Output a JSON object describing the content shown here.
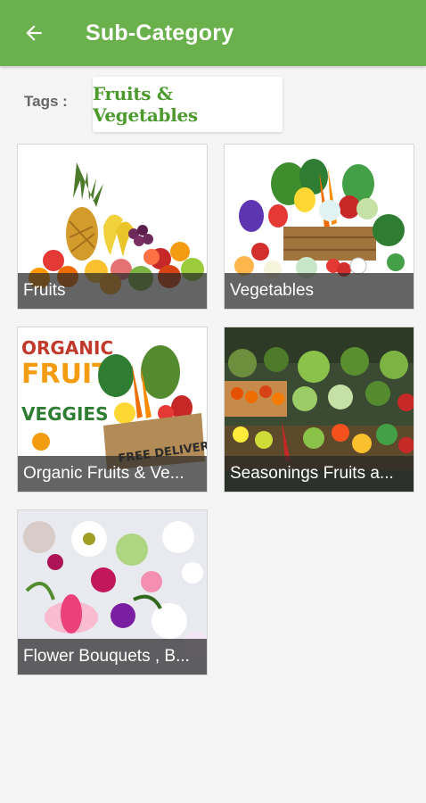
{
  "appbar": {
    "title": "Sub-Category",
    "back_icon": "arrow-back-icon",
    "color": "#6ab04c"
  },
  "tags": {
    "label": "Tags :",
    "selected": "Fruits & Vegetables"
  },
  "categories": [
    {
      "name": "Fruits",
      "image": "fruits-photo"
    },
    {
      "name": "Vegetables",
      "image": "vegetables-photo"
    },
    {
      "name": "Organic Fruits & Ve...",
      "image": "organic-fruits-veggies-photo"
    },
    {
      "name": "Seasonings Fruits a...",
      "image": "market-stall-photo"
    },
    {
      "name": "Flower Bouquets , B...",
      "image": "flower-bouquet-photo"
    }
  ],
  "organic_banner": {
    "line1": "ORGANIC",
    "line2": "FRUITS",
    "line3": "VEGGIES",
    "badge": "FREE DELIVERY!"
  }
}
